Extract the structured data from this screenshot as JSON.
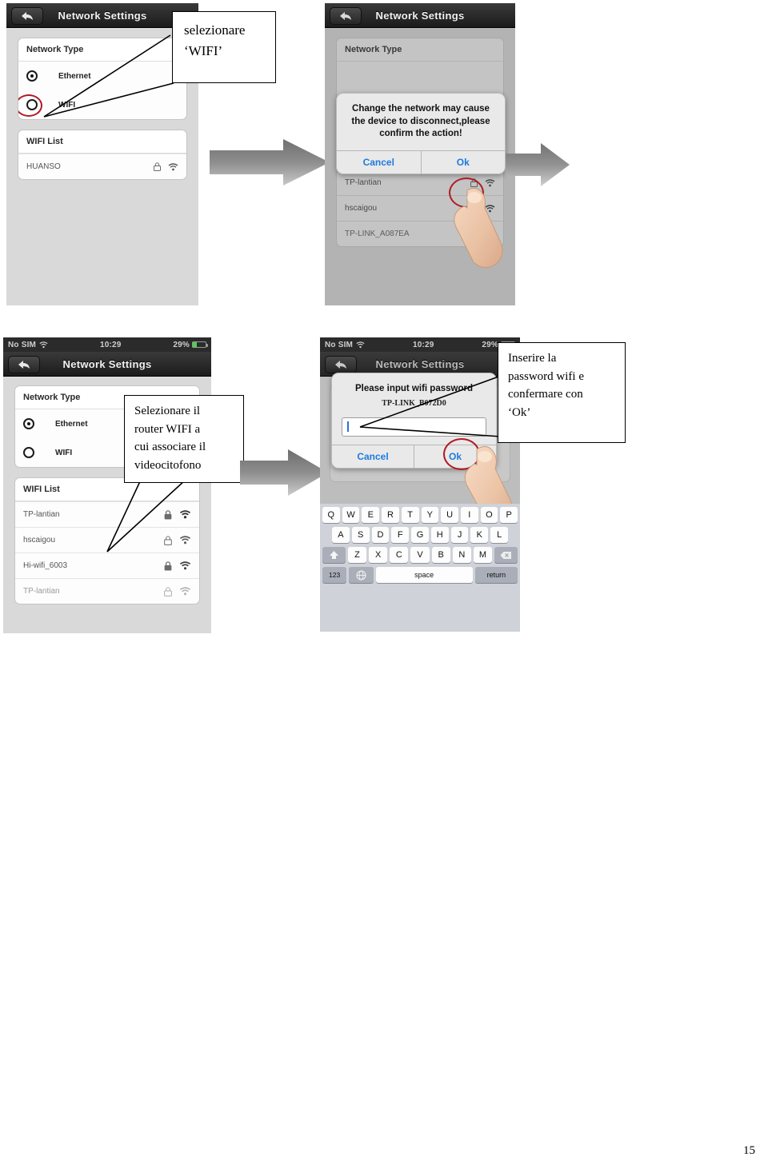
{
  "page": {
    "number": "15"
  },
  "colors": {
    "navbar_dark": "#2b2b2b",
    "accent_blue": "#1c7be0",
    "highlight_red": "#b01b24",
    "arrow_gray": "#8b8b8b",
    "screen_bg": "#d9d9d9"
  },
  "panels": {
    "step1": {
      "navbar_title": "Network Settings",
      "back_icon": "back-arrow-icon",
      "network_type": {
        "header": "Network Type",
        "options": [
          {
            "label": "Ethernet",
            "selected": true
          },
          {
            "label": "WIFI",
            "selected": false,
            "highlighted": true
          }
        ]
      },
      "wifi_list": {
        "header": "WIFI List",
        "items": [
          {
            "ssid": "HUANSO",
            "lock_icon": "lock-icon",
            "signal_icon": "wifi-signal-icon"
          }
        ]
      }
    },
    "step2": {
      "navbar_title": "Network Settings",
      "back_icon": "back-arrow-icon",
      "network_type": {
        "header": "Network Type"
      },
      "dialog": {
        "message": "Change the network may cause the device to disconnect,please confirm the action!",
        "cancel_label": "Cancel",
        "ok_label": "Ok",
        "ok_highlighted": true
      },
      "wifi_list": {
        "items": [
          {
            "ssid": "TP-lantian",
            "lock_icon": "lock-icon",
            "signal_icon": "wifi-signal-icon"
          },
          {
            "ssid": "hscaigou",
            "lock_icon": "lock-icon",
            "signal_icon": "wifi-signal-icon"
          },
          {
            "ssid": "TP-LINK_A087EA",
            "lock_icon": "lock-icon",
            "signal_icon": "wifi-signal-icon"
          }
        ]
      }
    },
    "step3": {
      "statusbar": {
        "carrier": "No SIM",
        "wifi_icon": "wifi-status-icon",
        "time": "10:29",
        "battery_percent": "29%",
        "battery_icon": "battery-icon"
      },
      "navbar_title": "Network Settings",
      "back_icon": "back-arrow-icon",
      "network_type": {
        "header": "Network Type",
        "options": [
          {
            "label": "Ethernet",
            "selected": true
          },
          {
            "label": "WIFI",
            "selected": false
          }
        ]
      },
      "wifi_list": {
        "header": "WIFI List",
        "items": [
          {
            "ssid": "TP-lantian",
            "lock_icon": "lock-icon",
            "signal_icon": "wifi-signal-icon"
          },
          {
            "ssid": "hscaigou",
            "lock_icon": "lock-icon",
            "signal_icon": "wifi-signal-icon"
          },
          {
            "ssid": "Hi-wifi_6003",
            "lock_icon": "lock-icon",
            "signal_icon": "wifi-signal-icon"
          },
          {
            "ssid": "TP-lantian",
            "lock_icon": "lock-icon",
            "signal_icon": "wifi-signal-icon"
          }
        ]
      }
    },
    "step4": {
      "statusbar": {
        "carrier": "No SIM",
        "wifi_icon": "wifi-status-icon",
        "time": "10:29",
        "battery_percent": "29%",
        "battery_icon": "battery-icon"
      },
      "navbar_title": "Network Settings",
      "back_icon": "back-arrow-icon",
      "dialog": {
        "title": "Please input wifi password",
        "ssid": "TP-LINK_B072D0",
        "input_value": "",
        "cancel_label": "Cancel",
        "ok_label": "Ok",
        "ok_highlighted": true
      },
      "keyboard": {
        "row1": [
          "Q",
          "W",
          "E",
          "R",
          "T",
          "Y",
          "U",
          "I",
          "O",
          "P"
        ],
        "row2": [
          "A",
          "S",
          "D",
          "F",
          "G",
          "H",
          "J",
          "K",
          "L"
        ],
        "row3": [
          "Z",
          "X",
          "C",
          "V",
          "B",
          "N",
          "M"
        ],
        "shift_icon": "shift-arrow-icon",
        "backspace_icon": "backspace-icon",
        "numeric_label": "123",
        "globe_icon": "globe-icon",
        "space_label": "space",
        "return_label": "return"
      }
    }
  },
  "callouts": {
    "c1": {
      "line1": "selezionare",
      "line2": "‘WIFI’"
    },
    "c2": {
      "line1": "Selezionare   il",
      "line2": "router  WIFI  a",
      "line3": "cui associare il",
      "line4": "videocitofono"
    },
    "c3": {
      "line1": "Inserire la",
      "line2": "password wifi e",
      "line3": "confermare con",
      "line4": "‘Ok’"
    }
  },
  "arrows": {
    "arrow1_name": "flow-arrow-right",
    "arrow2_name": "flow-arrow-right",
    "arrow3_name": "flow-arrow-right"
  }
}
